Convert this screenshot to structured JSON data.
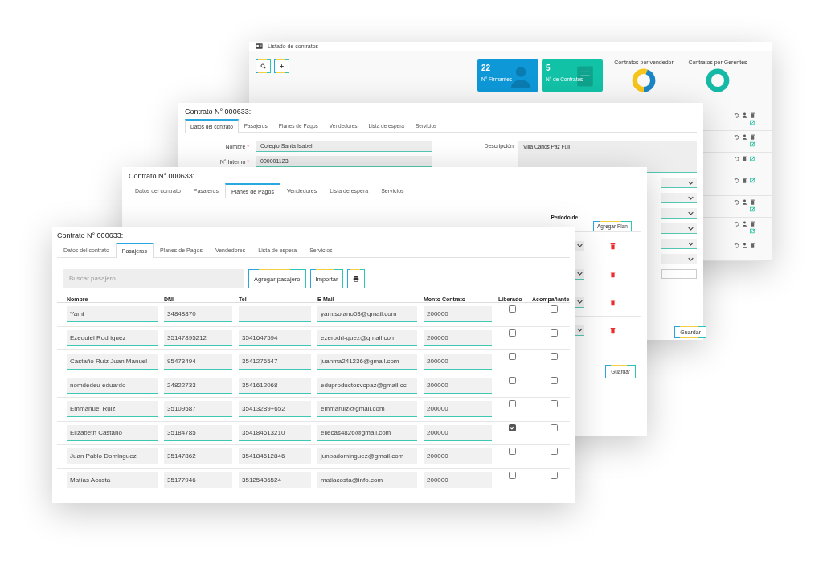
{
  "windows": [
    {
      "kind": "dashboard",
      "title": "Listado de contratos",
      "toolbar": [
        {
          "kind": "search"
        },
        {
          "kind": "add"
        }
      ],
      "stat_cards": [
        {
          "value": "22",
          "label": "N° Firmantes",
          "color": "#0e98d8"
        },
        {
          "value": "5",
          "label": "N° de Contratos",
          "color": "#12c2a7"
        }
      ],
      "charts": [
        {
          "title": "Contratos por vendedor",
          "segments": [
            {
              "color": "#f6c51b"
            },
            {
              "color": "#1b86c6"
            }
          ]
        },
        {
          "title": "Contratos por Gerentes",
          "segments": [
            {
              "color": "#16b9a6"
            }
          ]
        }
      ],
      "rows": [
        {
          "actions": [
            {
              "kind": "undo"
            },
            {
              "kind": "person"
            },
            {
              "kind": "trash"
            },
            {
              "kind": "edit"
            }
          ]
        },
        {
          "actions": [
            {
              "kind": "undo"
            },
            {
              "kind": "person"
            },
            {
              "kind": "trash"
            },
            {
              "kind": "edit"
            }
          ]
        },
        {
          "actions": [
            {
              "kind": "undo"
            },
            {
              "kind": "trash"
            },
            {
              "kind": "edit"
            }
          ]
        },
        {
          "actions": [
            {
              "kind": "undo"
            },
            {
              "kind": "trash"
            },
            {
              "kind": "edit"
            }
          ]
        },
        {
          "actions": [
            {
              "kind": "undo"
            },
            {
              "kind": "person"
            },
            {
              "kind": "trash"
            },
            {
              "kind": "edit"
            }
          ]
        },
        {
          "actions": [
            {
              "kind": "undo"
            },
            {
              "kind": "person"
            },
            {
              "kind": "trash"
            },
            {
              "kind": "edit"
            }
          ]
        },
        {
          "actions": [
            {
              "kind": "undo"
            },
            {
              "kind": "person"
            },
            {
              "kind": "trash"
            }
          ]
        }
      ]
    },
    {
      "kind": "contract_form",
      "title": "Contrato N° 000633:",
      "tabs": [
        {
          "label": "Datos del contrato",
          "selected": true
        },
        {
          "label": "Pasajeros",
          "selected": false
        },
        {
          "label": "Planes de Pagos",
          "selected": false
        },
        {
          "label": "Vendedores",
          "selected": false
        },
        {
          "label": "Lista de espera",
          "selected": false
        },
        {
          "label": "Servicios",
          "selected": false
        }
      ],
      "fields": [
        {
          "label": "Nombre",
          "mark": "*",
          "value": "Colegio Santa Isabel"
        },
        {
          "label": "N° Interno",
          "mark": "*",
          "value": "000001123"
        }
      ],
      "description": {
        "label": "Descripción",
        "value": "Villa Carlos Paz Full"
      },
      "extra_fields": [
        {
          "kind": "select"
        },
        {
          "kind": "select"
        },
        {
          "kind": "select"
        },
        {
          "kind": "select"
        },
        {
          "kind": "select"
        },
        {
          "kind": "select"
        },
        {
          "kind": "input"
        }
      ],
      "save_button": "Guardar"
    },
    {
      "kind": "payment_plans",
      "title": "Contrato N° 000633:",
      "tabs": [
        {
          "label": "Datos del contrato",
          "selected": false
        },
        {
          "label": "Pasajeros",
          "selected": false
        },
        {
          "label": "Planes de Pagos",
          "selected": true
        },
        {
          "label": "Vendedores",
          "selected": false
        },
        {
          "label": "Lista de espera",
          "selected": false
        },
        {
          "label": "Servicios",
          "selected": false
        }
      ],
      "period_header": "Período de",
      "add_button": "Agregar Plan",
      "rows": [
        {
          "kind": "plan"
        },
        {
          "kind": "plan"
        },
        {
          "kind": "plan"
        },
        {
          "kind": "plan"
        }
      ],
      "save_button": "Guardar"
    },
    {
      "kind": "passengers",
      "title": "Contrato N° 000633:",
      "tabs": [
        {
          "label": "Datos del contrato",
          "selected": false
        },
        {
          "label": "Pasajeros",
          "selected": true
        },
        {
          "label": "Planes de Pagos",
          "selected": false
        },
        {
          "label": "Vendedores",
          "selected": false
        },
        {
          "label": "Lista de espera",
          "selected": false
        },
        {
          "label": "Servicios",
          "selected": false
        }
      ],
      "search": {
        "placeholder": "Buscar pasajero"
      },
      "buttons": [
        "Agregar pasajero",
        "Importar"
      ],
      "columns": [
        "Nombre",
        "DNI",
        "Tel",
        "E-Mail",
        "Monto Contrato",
        "Liberado",
        "Acompañante"
      ],
      "rows": [
        {
          "nombre": "Yami",
          "dni": "34848870",
          "tel": "",
          "email": "yam.solano03@gmail.com",
          "monto": "200000",
          "liberado": false,
          "acompanante": false
        },
        {
          "nombre": "Ezequiel Rodriguez",
          "dni": "35147895212",
          "tel": "3541647594",
          "email": "ezerodri-guez@gmail.com",
          "monto": "200000",
          "liberado": false,
          "acompanante": false
        },
        {
          "nombre": "Castaño  Ruiz Juan Manuel",
          "dni": "95473494",
          "tel": "3541276547",
          "email": "juanma241236@gmail.com",
          "monto": "200000",
          "liberado": false,
          "acompanante": false
        },
        {
          "nombre": "nomdedeu eduardo",
          "dni": "24822733",
          "tel": "3541612068",
          "email": "eduproductosvcpaz@gmail.cc",
          "monto": "200000",
          "liberado": false,
          "acompanante": false
        },
        {
          "nombre": "Emmanuel Ruiz",
          "dni": "35109587",
          "tel": "35413289+652",
          "email": "emmaruiz@gmail.com",
          "monto": "200000",
          "liberado": false,
          "acompanante": false
        },
        {
          "nombre": "Elizabeth Castaño",
          "dni": "35184785",
          "tel": "354184613210",
          "email": "eliecas4826@gmail.com",
          "monto": "200000",
          "liberado": true,
          "acompanante": false
        },
        {
          "nombre": "Juan Pablo Dominguez",
          "dni": "35147862",
          "tel": "354184612846",
          "email": "junpadominguez@gmail.com",
          "monto": "200000",
          "liberado": false,
          "acompanante": false
        },
        {
          "nombre": "Matías Acosta",
          "dni": "35177946",
          "tel": "35125436524",
          "email": "matiacosta@info.com",
          "monto": "200000",
          "liberado": false,
          "acompanante": false
        }
      ]
    }
  ]
}
